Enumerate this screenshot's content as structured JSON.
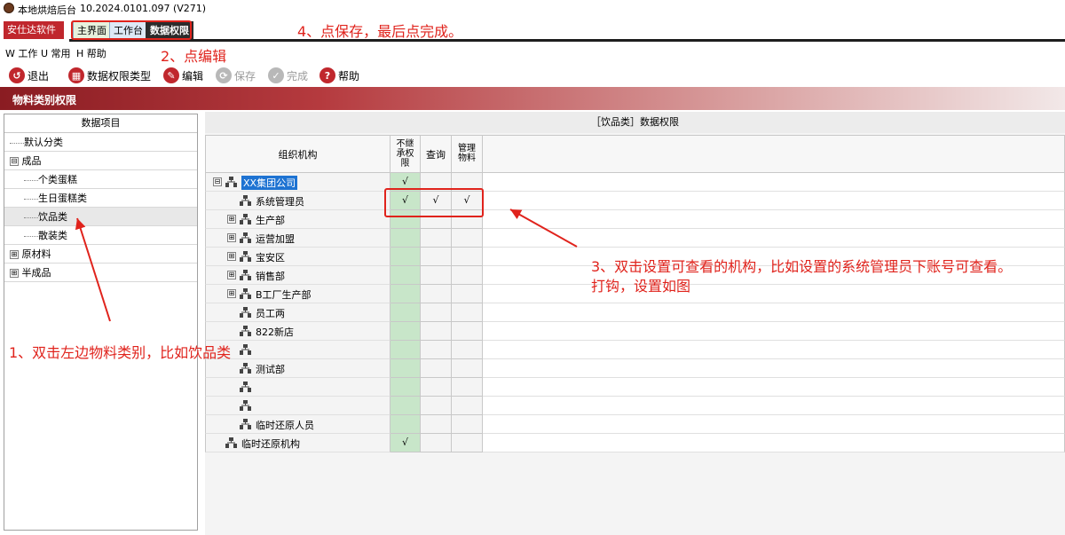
{
  "window": {
    "title": "本地烘焙后台",
    "version": "10.2024.0101.097 (V271)"
  },
  "company_button": "安仕达软件 ▾",
  "tabs": [
    {
      "label": "主界面"
    },
    {
      "label": "工作台"
    },
    {
      "label": "数据权限"
    }
  ],
  "menu": [
    {
      "label": "W 工作"
    },
    {
      "label": "U 常用"
    },
    {
      "label": "H 帮助"
    }
  ],
  "toolbar": {
    "exit": "退出",
    "perm_type": "数据权限类型",
    "edit": "编辑",
    "save": "保存",
    "finish": "完成",
    "help": "帮助"
  },
  "banner": "物料类别权限",
  "left_panel": {
    "header": "数据项目",
    "items": [
      {
        "label": "默认分类"
      },
      {
        "label": "成品",
        "expander": "⊟"
      },
      {
        "label": "个类蛋糕"
      },
      {
        "label": "生日蛋糕类"
      },
      {
        "label": "饮品类"
      },
      {
        "label": "散装类"
      },
      {
        "label": "原材料",
        "expander": "⊞"
      },
      {
        "label": "半成品",
        "expander": "⊞"
      }
    ]
  },
  "right_panel": {
    "caption": "［饮品类］数据权限",
    "columns": {
      "org": "组织机构",
      "inherit": "不继承权限",
      "query": "查询",
      "manage": "管理物料"
    },
    "rows": [
      {
        "label": "XX集团公司",
        "expander": "⊟",
        "inherit": "√",
        "query": "",
        "manage": ""
      },
      {
        "label": "系统管理员",
        "inherit": "√",
        "query": "√",
        "manage": "√"
      },
      {
        "label": "生产部",
        "expander": "⊞",
        "inherit": "",
        "query": "",
        "manage": ""
      },
      {
        "label": "运营加盟",
        "expander": "⊞",
        "inherit": "",
        "query": "",
        "manage": ""
      },
      {
        "label": "宝安区",
        "expander": "⊞",
        "inherit": "",
        "query": "",
        "manage": ""
      },
      {
        "label": "销售部",
        "expander": "⊞",
        "inherit": "",
        "query": "",
        "manage": ""
      },
      {
        "label": "B工厂生产部",
        "expander": "⊞",
        "inherit": "",
        "query": "",
        "manage": ""
      },
      {
        "label": "员工两",
        "inherit": "",
        "query": "",
        "manage": ""
      },
      {
        "label": "822新店",
        "inherit": "",
        "query": "",
        "manage": ""
      },
      {
        "label": "",
        "inherit": "",
        "query": "",
        "manage": ""
      },
      {
        "label": "测试部",
        "inherit": "",
        "query": "",
        "manage": ""
      },
      {
        "label": "",
        "inherit": "",
        "query": "",
        "manage": ""
      },
      {
        "label": "",
        "inherit": "",
        "query": "",
        "manage": ""
      },
      {
        "label": "临时还原人员",
        "inherit": "",
        "query": "",
        "manage": ""
      },
      {
        "label": "临时还原机构",
        "inherit": "√",
        "query": "",
        "manage": ""
      }
    ]
  },
  "annotations": {
    "step1": "1、双击左边物料类别，比如饮品类",
    "step2": "2、点编辑",
    "step3_line1": "3、双击设置可查看的机构，比如设置的系统管理员下账号可查看。",
    "step3_line2": "打钩，设置如图",
    "step4": "4、点保存，最后点完成。"
  },
  "colors": {
    "accent_red": "#c0272d",
    "annotation_red": "#e0231c",
    "green_column": "#c8e6c9",
    "selection_blue": "#1e73d2"
  }
}
